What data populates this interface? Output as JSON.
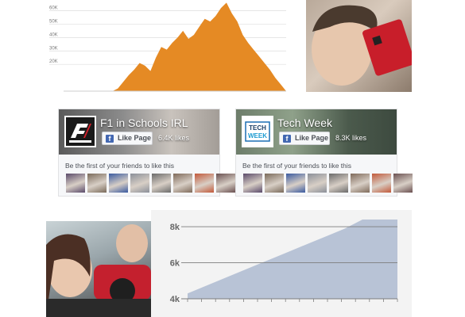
{
  "chart_top": {
    "type": "area",
    "color": "#e58a24",
    "yticks": [
      "20K",
      "30K",
      "40K",
      "50K",
      "60K"
    ],
    "values": [
      0,
      0,
      0,
      0,
      0,
      0,
      0,
      0,
      0,
      0,
      2000,
      7000,
      12000,
      16000,
      21000,
      19000,
      15000,
      25000,
      33000,
      31000,
      36000,
      40000,
      45000,
      39000,
      42000,
      48000,
      54000,
      52000,
      56000,
      62000,
      66000,
      58000,
      52000,
      42000,
      36000,
      31000,
      26000,
      21000,
      16000,
      10000,
      5000,
      0
    ],
    "ylim": [
      0,
      68000
    ]
  },
  "chart_bottom": {
    "type": "area",
    "color": "#b8c3d6",
    "yticks": [
      "4k",
      "6k",
      "8k"
    ],
    "values": [
      4300,
      4700,
      5100,
      5500,
      5900,
      6300,
      6700,
      7100,
      7500,
      7900,
      8400,
      8400,
      8400
    ],
    "ylim": [
      4000,
      8400
    ]
  },
  "pages": [
    {
      "name": "F1 in Schools IRL",
      "like_label": "Like Page",
      "likes": "6.4K likes",
      "friends_text": "Be the first of your friends to like this",
      "logo_icon": "f1-in-schools-logo-icon",
      "avatar_colors": [
        "#5a4a6a",
        "#7a6a5a",
        "#3a5aa0",
        "#8a8f99",
        "#6a6a6a",
        "#7f6a5a",
        "#c2593a",
        "#6a5050"
      ]
    },
    {
      "name": "Tech Week",
      "like_label": "Like Page",
      "likes": "8.3K likes",
      "friends_text": "Be the first of your friends to like this",
      "logo_icon": "tech-week-logo-icon",
      "avatar_colors": [
        "#5a4a6a",
        "#7a6a5a",
        "#3a5aa0",
        "#8a8f99",
        "#6a6a6a",
        "#7f6a5a",
        "#c2593a",
        "#6a5050"
      ]
    }
  ],
  "photos": [
    {
      "icon": "boy-with-circuit-board-photo"
    },
    {
      "icon": "students-with-f1-car-photo"
    }
  ]
}
